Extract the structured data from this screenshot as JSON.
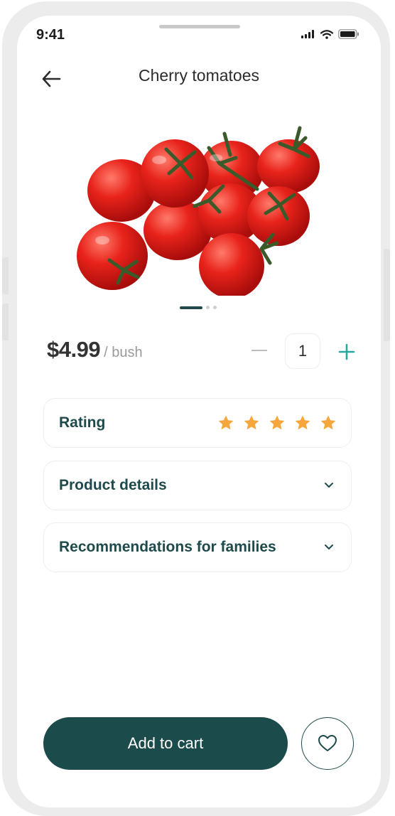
{
  "status_bar": {
    "time": "9:41"
  },
  "header": {
    "title": "Cherry tomatoes",
    "back_icon": "arrow-left-icon"
  },
  "product": {
    "image": "cherry-tomatoes-photo",
    "carousel": {
      "pages": 3,
      "active_index": 0
    },
    "price": "$4.99",
    "unit": "/ bush",
    "quantity": "1"
  },
  "sections": {
    "rating": {
      "label": "Rating",
      "stars": 5,
      "star_color": "#f6a63a"
    },
    "details": {
      "label": "Product details"
    },
    "recommendations": {
      "label": "Recommendations for families"
    }
  },
  "actions": {
    "add_to_cart": "Add to cart",
    "favorite_icon": "heart-icon"
  },
  "colors": {
    "primary": "#1c4b4b",
    "accent_plus": "#2aa7a0"
  }
}
